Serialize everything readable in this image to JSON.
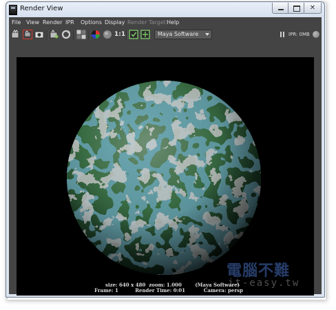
{
  "window": {
    "title": "Render View"
  },
  "menu": [
    {
      "label": "File",
      "disabled": false
    },
    {
      "label": "View",
      "disabled": false
    },
    {
      "label": "Render",
      "disabled": false
    },
    {
      "label": "IPR",
      "disabled": false
    },
    {
      "label": "Options",
      "disabled": false
    },
    {
      "label": "Display",
      "disabled": false
    },
    {
      "label": "Render Target",
      "disabled": true
    },
    {
      "label": "Help",
      "disabled": false
    }
  ],
  "toolbar": {
    "zoom_ratio": "1:1",
    "renderer": "Maya Software",
    "ipr_status": "IPR: 0MB"
  },
  "render_info": {
    "line1": "size: 640 x 480  zoom: 1.000        (Maya Software)",
    "line2": "Frame: 1          Render Time: 0:01           Camera: persp"
  },
  "watermark": {
    "line1": "電腦不難",
    "line2": "it-easy.tw"
  },
  "colors": {
    "panel_bg": "#444444",
    "viewport_bg": "#000000",
    "sphere_green": "#2f8a3e",
    "sphere_blue": "#2e6f86",
    "sphere_gray": "#8e938f"
  }
}
